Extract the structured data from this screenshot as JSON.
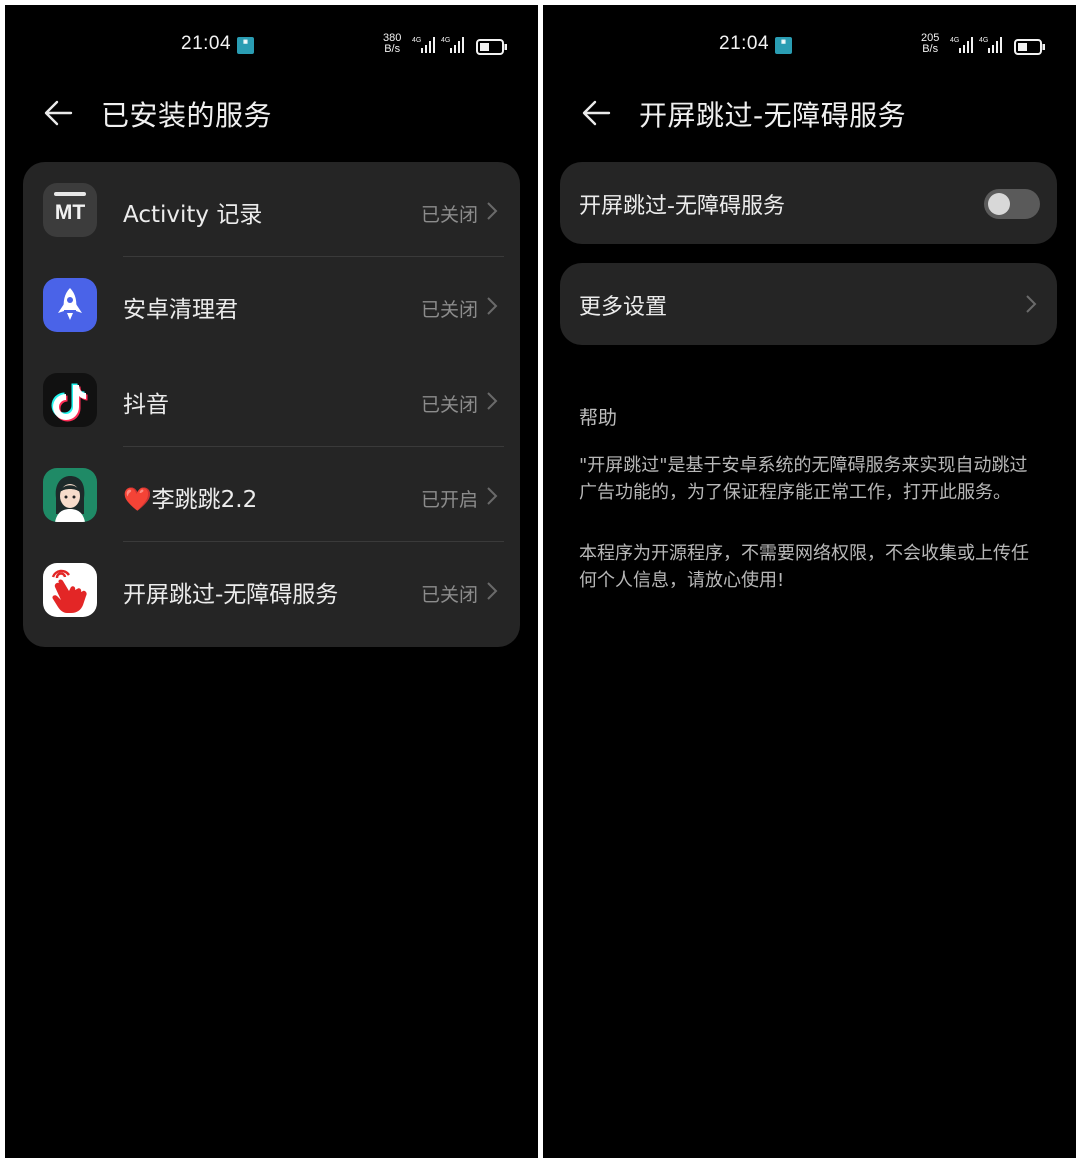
{
  "left": {
    "status_bar": {
      "time": "21:04",
      "speed_value": "380",
      "speed_unit": "B/s"
    },
    "title": "已安装的服务",
    "items": [
      {
        "label": "Activity 记录",
        "status": "已关闭",
        "icon": "mt-app-icon",
        "icon_text": "MT"
      },
      {
        "label": "安卓清理君",
        "status": "已关闭",
        "icon": "rocket-app-icon"
      },
      {
        "label": "抖音",
        "status": "已关闭",
        "icon": "tiktok-app-icon"
      },
      {
        "label": "❤️李跳跳2.2",
        "status": "已开启",
        "icon": "avatar-app-icon"
      },
      {
        "label": "开屏跳过-无障碍服务",
        "status": "已关闭",
        "icon": "tap-hand-app-icon"
      }
    ]
  },
  "right": {
    "status_bar": {
      "time": "21:04",
      "speed_value": "205",
      "speed_unit": "B/s"
    },
    "title": "开屏跳过-无障碍服务",
    "toggle_label": "开屏跳过-无障碍服务",
    "toggle_on": false,
    "more_settings_label": "更多设置",
    "help_title": "帮助",
    "help_p1": "\"开屏跳过\"是基于安卓系统的无障碍服务来实现自动跳过广告功能的，为了保证程序能正常工作，打开此服务。",
    "help_p2": "本程序为开源程序，不需要网络权限，不会收集或上传任何个人信息，请放心使用!"
  },
  "colors": {
    "background": "#000000",
    "card": "#252525",
    "text_primary": "#ececec",
    "text_secondary": "#8c8c8c",
    "toggle_off": "#5a5a5a"
  }
}
